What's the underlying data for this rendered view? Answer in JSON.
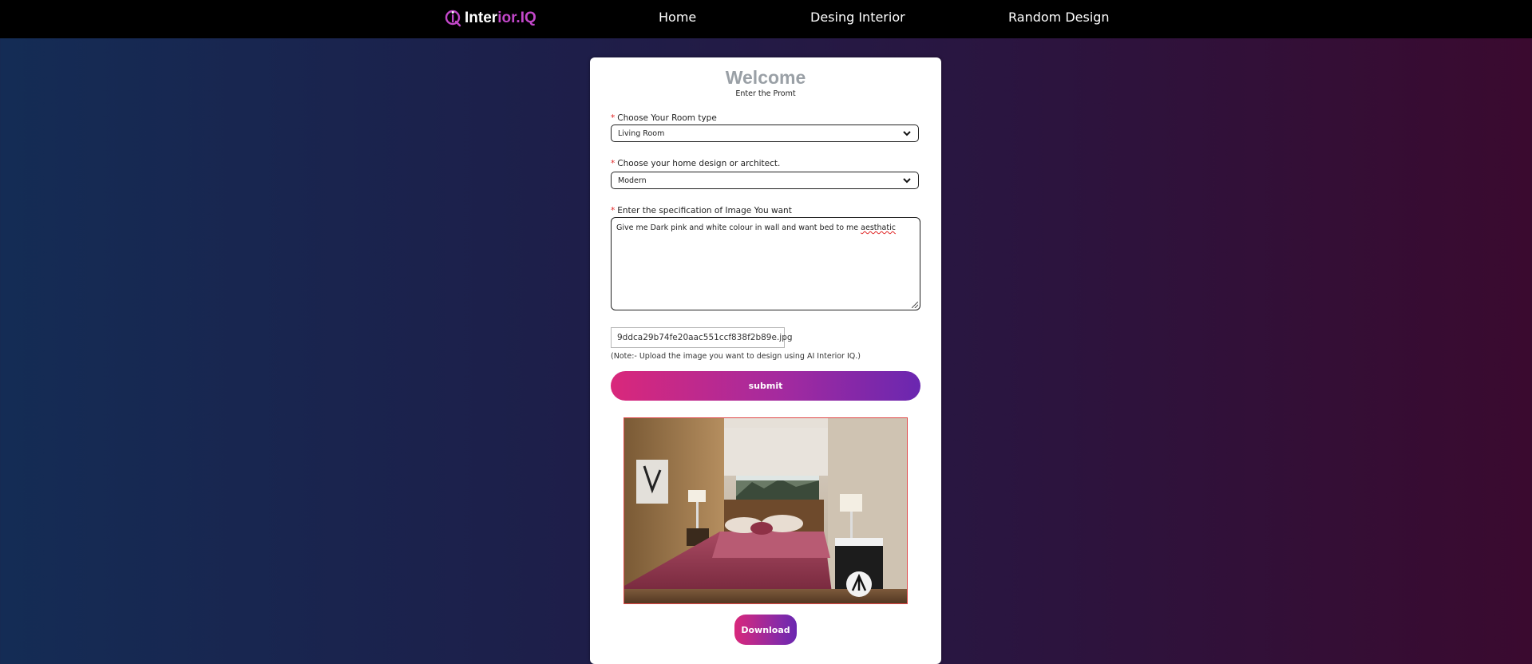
{
  "nav": {
    "logo_text_1": "Inter",
    "logo_text_2": "ior.IQ",
    "links": [
      "Home",
      "Desing Interior",
      "Random Design"
    ]
  },
  "card": {
    "title": "Welcome",
    "subtitle": "Enter the Promt",
    "room_type": {
      "label": "Choose Your Room type",
      "value": "Living Room"
    },
    "design": {
      "label": "Choose your home design or architect.",
      "value": "Modern"
    },
    "specification": {
      "label": "Enter the specification of Image You want",
      "value_before": "Give me Dark pink and white colour in wall and want bed to me ",
      "value_misspelled": "aesthatic"
    },
    "file": {
      "name": "9ddca29b74fe20aac551ccf838f2b89e.jpg",
      "note": "(Note:- Upload the image you want to design using AI Interior IQ.)"
    },
    "submit_label": "submit",
    "download_label": "Download"
  },
  "colors": {
    "accent_pink": "#d9287b",
    "accent_purple": "#6a27b0",
    "title_gray": "#9aa0a6",
    "required_red": "#e02424"
  }
}
